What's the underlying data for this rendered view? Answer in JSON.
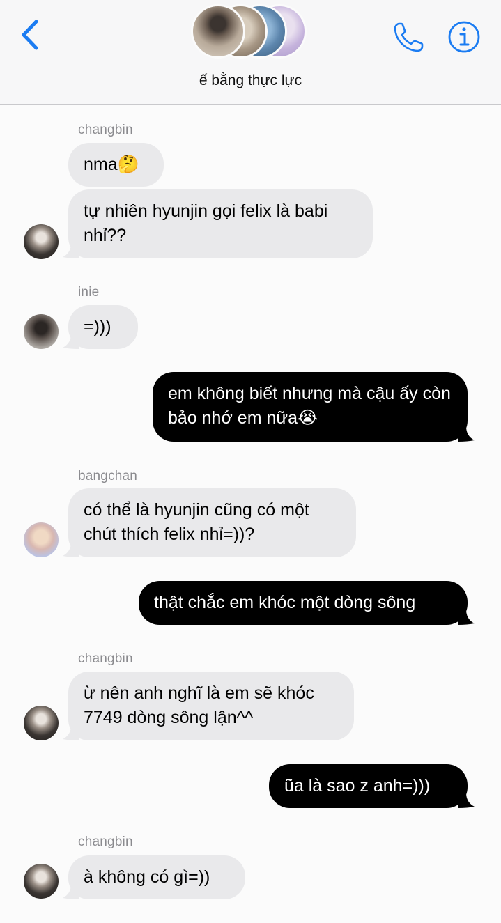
{
  "header": {
    "back_icon": "chevron-left-icon",
    "group_name": "ế bằng thực lực",
    "call_icon": "phone-icon",
    "info_icon": "info-icon",
    "accent_color": "#1b7cf2"
  },
  "messages": [
    {
      "sender": "changbin"
    },
    {
      "text": "nma🤔"
    },
    {
      "text": "tự nhiên hyunjin gọi felix là babi nhỉ??"
    },
    {
      "sender": "inie"
    },
    {
      "text": "=)))"
    },
    {
      "text": "em không biết nhưng mà cậu ấy còn bảo nhớ em nữa😭"
    },
    {
      "sender": "bangchan"
    },
    {
      "text": "có thể là hyunjin cũng có một chút thích felix nhỉ=))?"
    },
    {
      "text": "thật chắc em khóc một dòng sông"
    },
    {
      "sender": "changbin"
    },
    {
      "text": "ừ nên anh nghĩ là em sẽ khóc 7749 dòng sông lận^^"
    },
    {
      "text": "ũa là sao z anh=)))"
    },
    {
      "sender": "changbin"
    },
    {
      "text": "à không có gì=))"
    }
  ],
  "colors": {
    "incoming_bubble": "#e9e9eb",
    "outgoing_bubble": "#000000",
    "sender_label": "#8a8a8e"
  }
}
